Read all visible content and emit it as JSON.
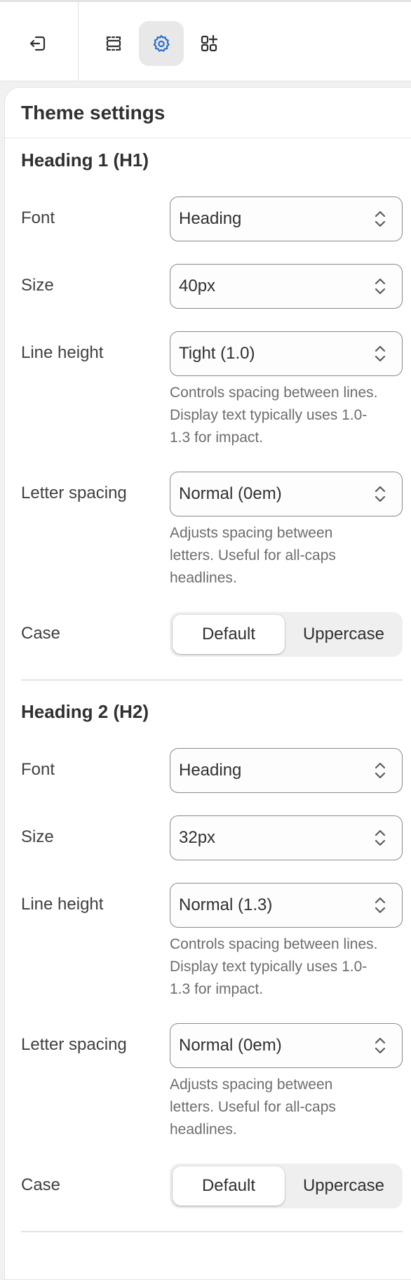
{
  "toolbar": {
    "exit_icon": "exit-icon",
    "sections_icon": "sections-icon",
    "settings_icon": "settings-gear-icon",
    "apps_icon": "apps-add-icon",
    "accent": "#2c6ecb"
  },
  "panel": {
    "title": "Theme settings"
  },
  "h1": {
    "title": "Heading 1 (H1)",
    "font_label": "Font",
    "font_value": "Heading",
    "size_label": "Size",
    "size_value": "40px",
    "lh_label": "Line height",
    "lh_value": "Tight (1.0)",
    "lh_help": "Controls spacing between lines. Display text typically uses 1.0-1.3 for impact.",
    "ls_label": "Letter spacing",
    "ls_value": "Normal (0em)",
    "ls_help": "Adjusts spacing between letters. Useful for all-caps headlines.",
    "case_label": "Case",
    "case_default": "Default",
    "case_upper": "Uppercase",
    "case_selected": "Default"
  },
  "h2": {
    "title": "Heading 2 (H2)",
    "font_label": "Font",
    "font_value": "Heading",
    "size_label": "Size",
    "size_value": "32px",
    "lh_label": "Line height",
    "lh_value": "Normal (1.3)",
    "lh_help": "Controls spacing between lines. Display text typically uses 1.0-1.3 for impact.",
    "ls_label": "Letter spacing",
    "ls_value": "Normal (0em)",
    "ls_help": "Adjusts spacing between letters. Useful for all-caps headlines.",
    "case_label": "Case",
    "case_default": "Default",
    "case_upper": "Uppercase",
    "case_selected": "Default"
  }
}
